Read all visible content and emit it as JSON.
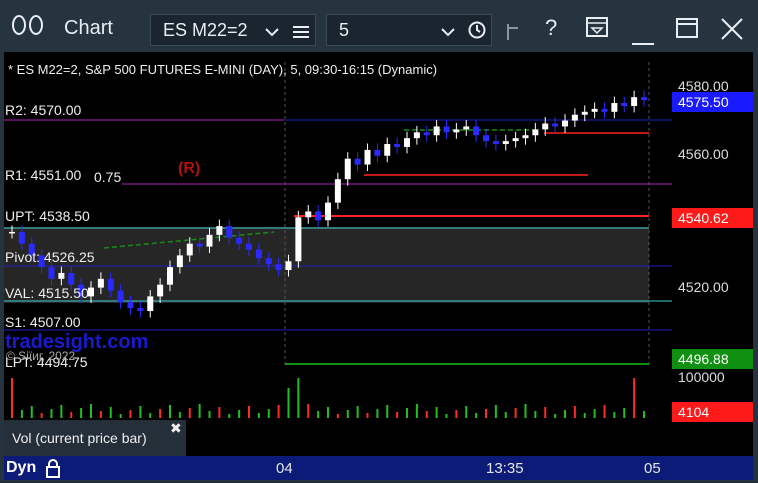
{
  "window": {
    "title": "Chart",
    "symbol_select": "ES M22=2",
    "interval_select": "5",
    "help_label": "?"
  },
  "chart": {
    "header": "* ES M22=2, S&P 500 FUTURES E-MINI (DAY), 5, 09:30-16:15 (Dynamic)",
    "watermark": "tradesight.com",
    "copyright": "© Siїиг, 2022",
    "r_marker": "(R)",
    "levels": {
      "r2": "R2: 4570.00",
      "r1": "R1: 4551.00",
      "r1_extra": "0.75",
      "upt": "UPT: 4538.50",
      "pivot": "Pivot: 4526.25",
      "val": "VAL: 4515.50",
      "s1": "S1: 4507.00",
      "lpt": "LPT: 4494.75"
    },
    "price_axis": {
      "ticks": [
        "4580.00",
        "4560.00",
        "4520.00"
      ],
      "current_price": "4575.50",
      "red_label": "4540.62",
      "green_label": "4496.88"
    },
    "volume_axis": {
      "max_tick": "100000",
      "current_volume": "4104"
    },
    "time_axis": {
      "labels": [
        "04",
        "13:35",
        "05"
      ]
    },
    "legend_text": "Vol (current price bar)",
    "legend_close": "✖",
    "bottom_label": "Dyn"
  },
  "colors": {
    "accent_blue": "#1010d0",
    "level_magenta": "#b020b0",
    "level_red": "#ff2020",
    "level_blue": "#2020c0",
    "level_cyan": "#40d0d0",
    "price_label_blue": "#1a1aff",
    "price_label_red": "#ff1a1a",
    "price_label_green": "#109010"
  },
  "chart_data": {
    "type": "candlestick",
    "y_range": [
      4488,
      4588
    ],
    "note": "approximate closes read from chart",
    "closes": [
      4530,
      4526,
      4522,
      4518,
      4514,
      4516,
      4512,
      4508,
      4511,
      4514,
      4510,
      4506,
      4504,
      4503,
      4508,
      4512,
      4518,
      4522,
      4526,
      4525,
      4529,
      4532,
      4528,
      4526,
      4524,
      4521,
      4519,
      4517,
      4520,
      4535,
      4537,
      4534,
      4540,
      4548,
      4555,
      4553,
      4558,
      4556,
      4560,
      4559,
      4562,
      4564,
      4563,
      4566,
      4564,
      4565,
      4566,
      4563,
      4561,
      4560,
      4561,
      4562,
      4563,
      4565,
      4567,
      4566,
      4568,
      4570,
      4571,
      4572,
      4571,
      4574,
      4573,
      4576,
      4575
    ]
  }
}
